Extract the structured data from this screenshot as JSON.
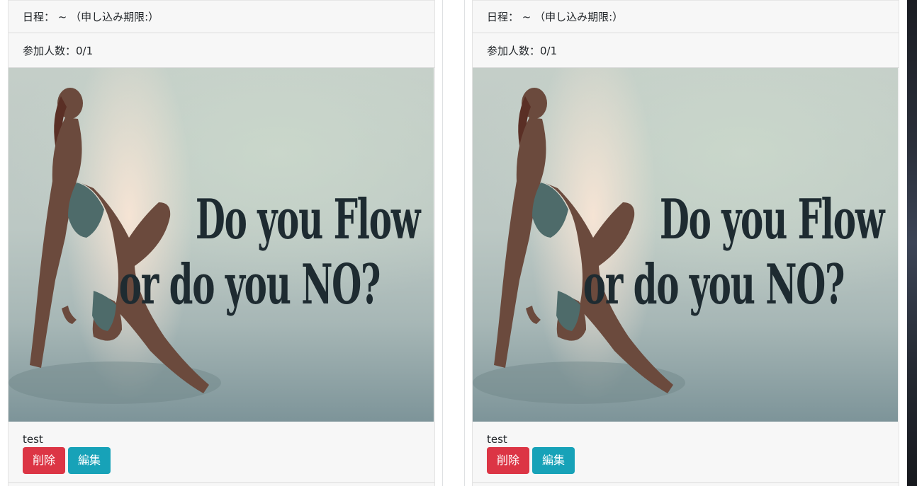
{
  "cards": [
    {
      "date_label": "日程： ~ （申し込み期限:）",
      "participants_label": "参加人数：0/1",
      "image": {
        "caption_line1": "Do you Flow",
        "caption_line2": "or do you NO?"
      },
      "event_name": "test",
      "delete_label": "削除",
      "edit_label": "編集"
    },
    {
      "date_label": "日程： ~ （申し込み期限:）",
      "participants_label": "参加人数：0/1",
      "image": {
        "caption_line1": "Do you Flow",
        "caption_line2": "or do you NO?"
      },
      "event_name": "test",
      "delete_label": "削除",
      "edit_label": "編集"
    }
  ],
  "colors": {
    "danger": "#dc3545",
    "info": "#17a2b8",
    "card_bg": "#f7f7f7"
  }
}
